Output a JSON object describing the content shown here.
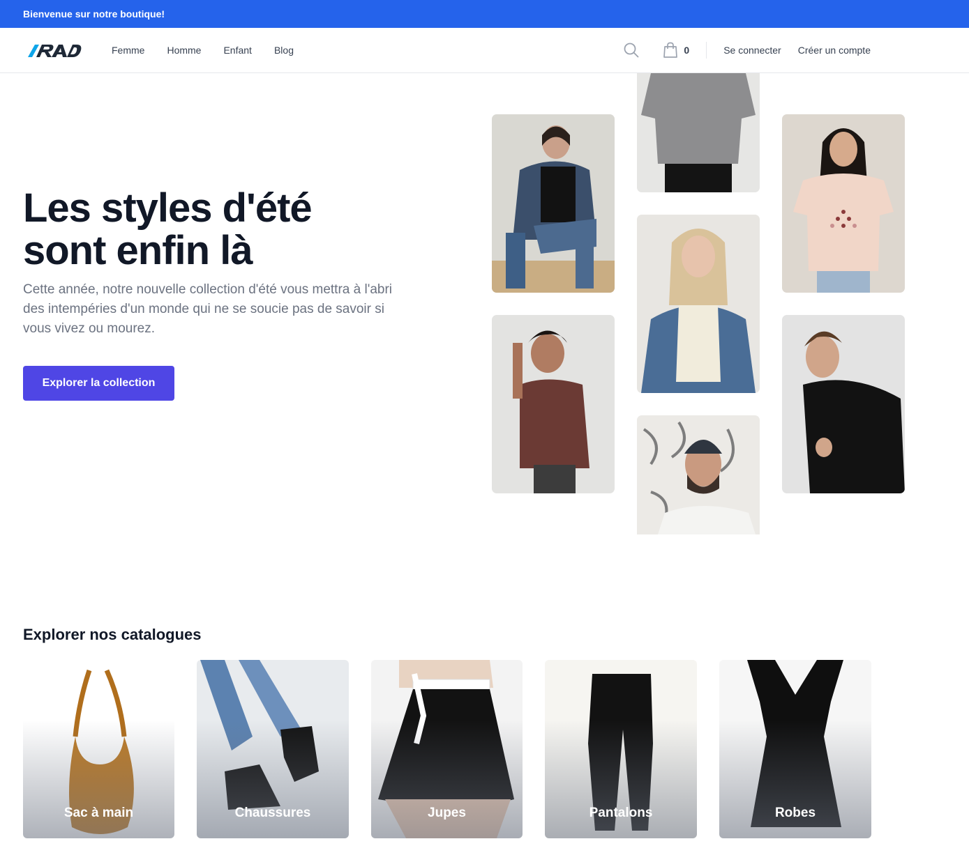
{
  "announcement": "Bienvenue sur notre boutique!",
  "nav": {
    "links": [
      "Femme",
      "Homme",
      "Enfant",
      "Blog"
    ],
    "cart_count": "0",
    "sign_in": "Se connecter",
    "create_account": "Créer un compte"
  },
  "hero": {
    "title_line1": "Les styles d'été",
    "title_line2": "sont enfin là",
    "text": "Cette année, notre nouvelle collection d'été vous mettra à l'abri des intempéries d'un monde qui ne se soucie pas de savoir si vous vivez ou mourez.",
    "cta": "Explorer la collection"
  },
  "catalog": {
    "heading": "Explorer nos catalogues",
    "items": [
      "Sac à main",
      "Chaussures",
      "Jupes",
      "Pantalons",
      "Robes"
    ]
  },
  "colors": {
    "announcement_bg": "#2563eb",
    "cta_bg": "#4f46e5",
    "logo_blue": "#0ea5e9"
  }
}
